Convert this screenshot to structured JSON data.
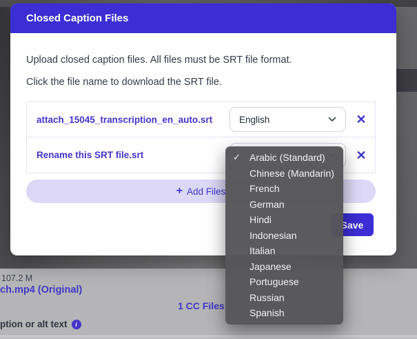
{
  "modal": {
    "title": "Closed Caption Files",
    "instructions": [
      "Upload closed caption files. All files must be SRT file format.",
      "Click the file name to download the SRT file."
    ],
    "files": [
      {
        "name": "attach_15045_transcription_en_auto.srt",
        "language": "English"
      },
      {
        "name": "Rename this SRT file.srt"
      }
    ],
    "add_files_plus": "+",
    "add_files_label": "Add Files",
    "save_label": "Save"
  },
  "dropdown": {
    "selected": "Arabic (Standard)",
    "check_glyph": "✓",
    "options": [
      "Arabic (Standard)",
      "Chinese (Mandarin)",
      "French",
      "German",
      "Hindi",
      "Indonesian",
      "Italian",
      "Japanese",
      "Portuguese",
      "Russian",
      "Spanish"
    ]
  },
  "background": {
    "file_size": "107.2 M",
    "file_name": "ch.mp4 (Original)",
    "cc_files_label": "1 CC Files",
    "caption_label": "ption or alt text",
    "info_glyph": "i"
  },
  "remove_glyph": "✕",
  "colors": {
    "accent": "#3c2ed4",
    "link": "#4334cb",
    "add_files_bg": "#dcd8f6",
    "dropdown_bg": "#565658",
    "bottom_panel": "#b5b5b7"
  }
}
